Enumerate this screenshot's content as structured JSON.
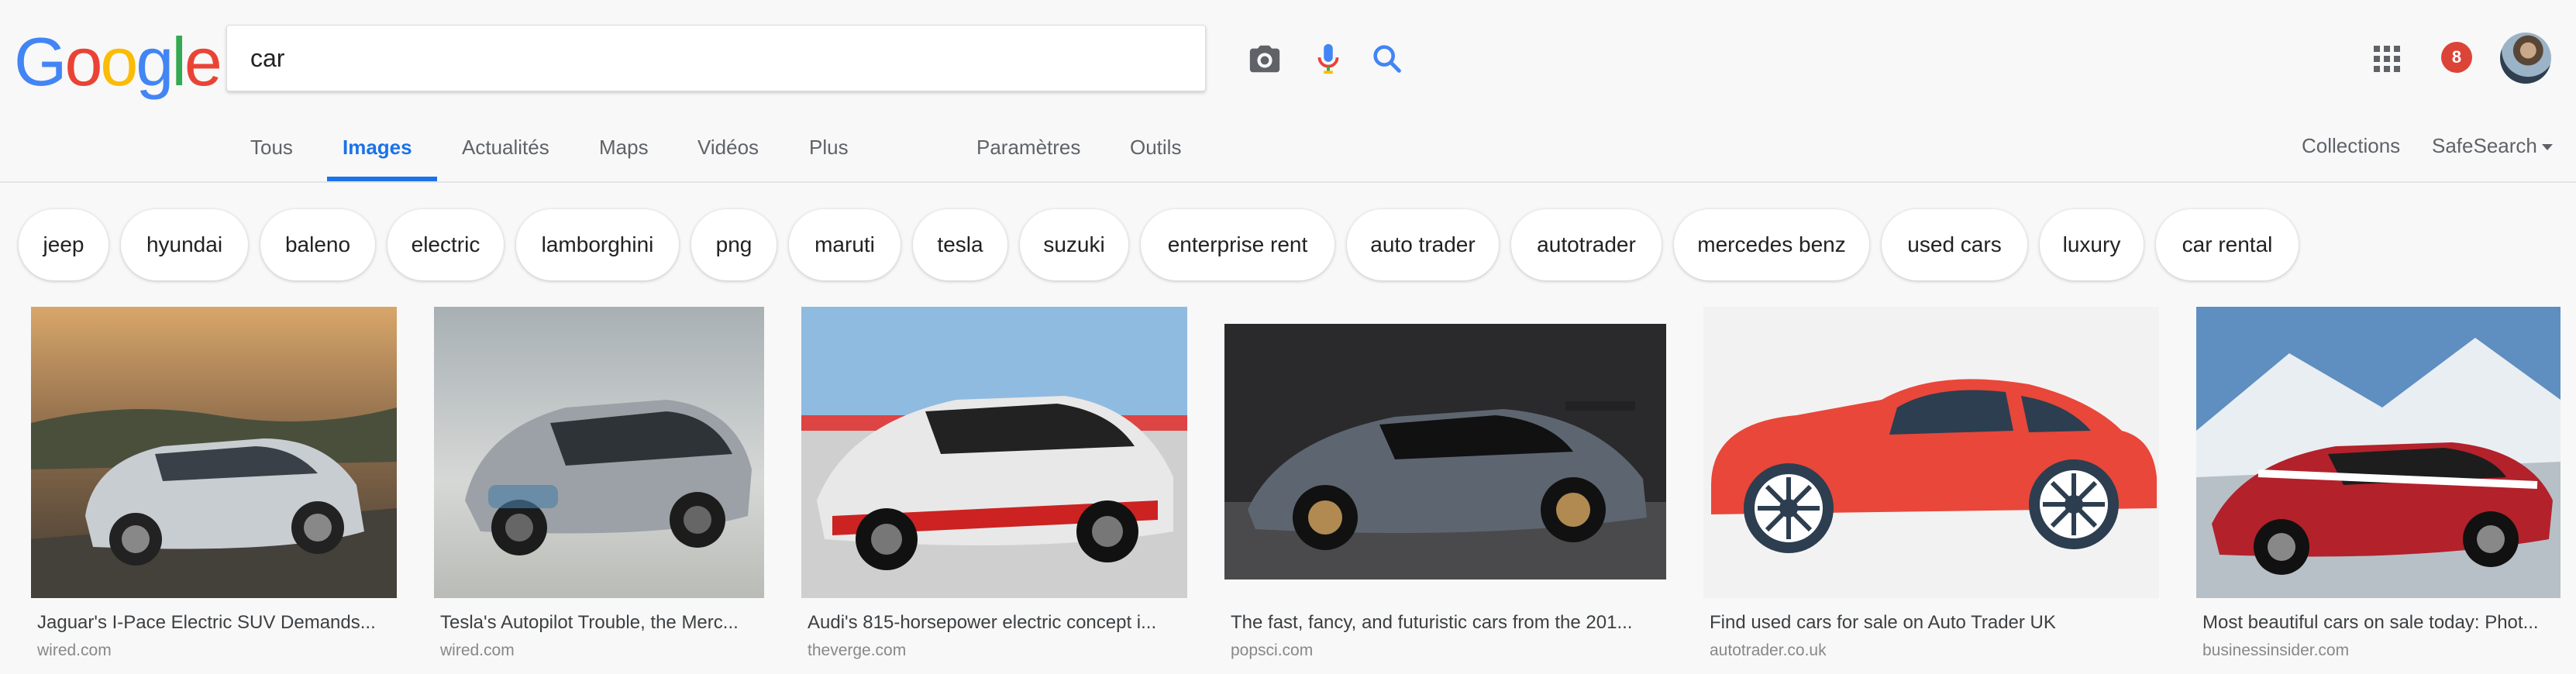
{
  "search": {
    "query": "car"
  },
  "logo": {
    "letters": [
      "G",
      "o",
      "o",
      "g",
      "l",
      "e"
    ],
    "colors": [
      "#4285F4",
      "#EA4335",
      "#FBBC05",
      "#4285F4",
      "#34A853",
      "#EA4335"
    ]
  },
  "header": {
    "notification_count": "8"
  },
  "nav": {
    "tabs": [
      "Tous",
      "Images",
      "Actualités",
      "Maps",
      "Vidéos",
      "Plus"
    ],
    "active_tab": "Images",
    "settings": "Paramètres",
    "tools": "Outils",
    "collections": "Collections",
    "safesearch": "SafeSearch"
  },
  "chips": [
    "jeep",
    "hyundai",
    "baleno",
    "electric",
    "lamborghini",
    "png",
    "maruti",
    "tesla",
    "suzuki",
    "enterprise rent",
    "auto trader",
    "autotrader",
    "mercedes benz",
    "used cars",
    "luxury",
    "car rental"
  ],
  "results": [
    {
      "caption": "Jaguar's I-Pace Electric SUV Demands...",
      "domain": "wired.com"
    },
    {
      "caption": "Tesla's Autopilot Trouble, the Merc...",
      "domain": "wired.com"
    },
    {
      "caption": "Audi's 815-horsepower electric concept i...",
      "domain": "theverge.com"
    },
    {
      "caption": "The fast, fancy, and futuristic cars from the 201...",
      "domain": "popsci.com"
    },
    {
      "caption": "Find used cars for sale on Auto Trader UK",
      "domain": "autotrader.co.uk"
    },
    {
      "caption": "Most beautiful cars on sale today: Phot...",
      "domain": "businessinsider.com"
    }
  ],
  "colors": {
    "accent": "#1a73e8",
    "badge": "#db4437"
  }
}
